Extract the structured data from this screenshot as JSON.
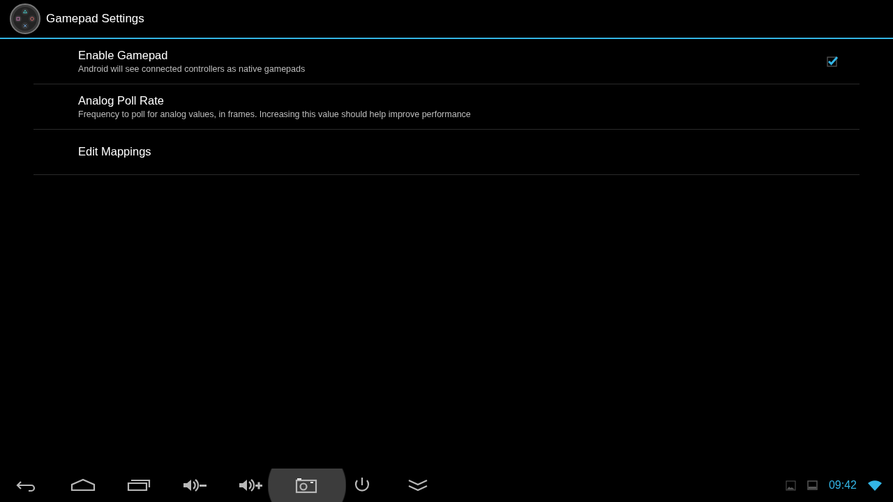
{
  "action_bar": {
    "title": "Gamepad Settings"
  },
  "preferences": [
    {
      "kind": "checkbox",
      "title": "Enable Gamepad",
      "summary": "Android will see connected controllers as native gamepads",
      "checked": true
    },
    {
      "kind": "plain",
      "title": "Analog Poll Rate",
      "summary": "Frequency to poll for analog values, in frames. Increasing this value should help improve performance"
    },
    {
      "kind": "plain",
      "title": "Edit Mappings"
    }
  ],
  "nav_buttons": [
    {
      "kind": "back",
      "pressed": false
    },
    {
      "kind": "home",
      "pressed": false
    },
    {
      "kind": "recents",
      "pressed": false
    },
    {
      "kind": "volume-down",
      "pressed": false
    },
    {
      "kind": "volume-up",
      "pressed": false
    },
    {
      "kind": "screenshot",
      "pressed": true
    },
    {
      "kind": "power",
      "pressed": false
    },
    {
      "kind": "collapse",
      "pressed": false
    }
  ],
  "status": {
    "time": "09:42"
  }
}
